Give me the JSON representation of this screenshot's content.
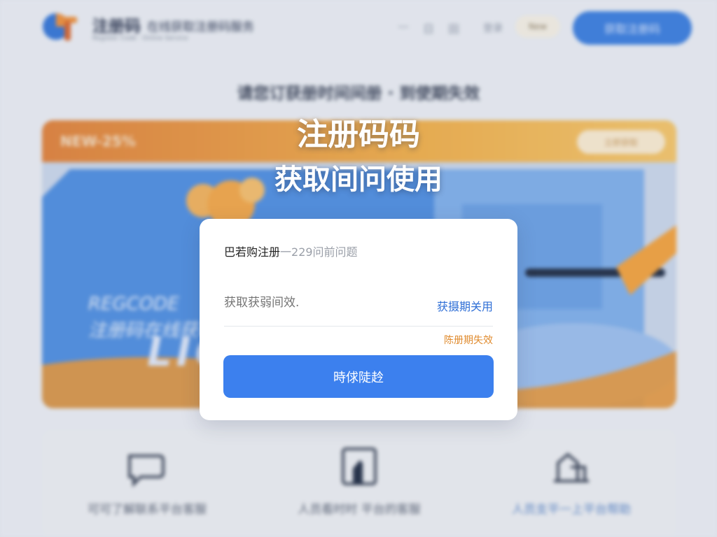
{
  "header": {
    "brand_title": "注册码",
    "brand_subtitle": "在线获取注册码服务",
    "brand_tagline": "Register Code · Online Service",
    "nav_minimize": "—",
    "nav_item_1": "日",
    "nav_item_2": "田",
    "nav_link": "登录",
    "nav_pill": "New",
    "cta_button": "获取注册码"
  },
  "page": {
    "headline": "请您订获册时间间册 · 到使期失效",
    "banner_badge": "NEW-25%",
    "banner_pill": "立即获取",
    "banner_line_1": "REGCODE",
    "banner_line_2": "注册码在线获取",
    "banner_big": "LIC"
  },
  "features": [
    {
      "label": "可可了解联系平台客服",
      "icon": "chat-icon"
    },
    {
      "label": "人员看时时 平台的客服",
      "icon": "support-icon"
    },
    {
      "label": "人员支平一上平台帮助",
      "icon": "help-icon"
    }
  ],
  "overlay": {
    "title_line_1": "注册码码",
    "title_line_2": "获取间问使用"
  },
  "dialog": {
    "title": "巴若购注册",
    "title_suffix": "一229问前问题",
    "input_placeholder": "获取获弱间效.",
    "get_code_link": "获摄期关用",
    "hint": "陈册期失效",
    "submit_button": "時俅陡赺"
  },
  "colors": {
    "primary_blue": "#3c80ee",
    "link_blue": "#2f6fd6",
    "warning_orange": "#e08b2e",
    "banner_orange": "#e2823a"
  }
}
